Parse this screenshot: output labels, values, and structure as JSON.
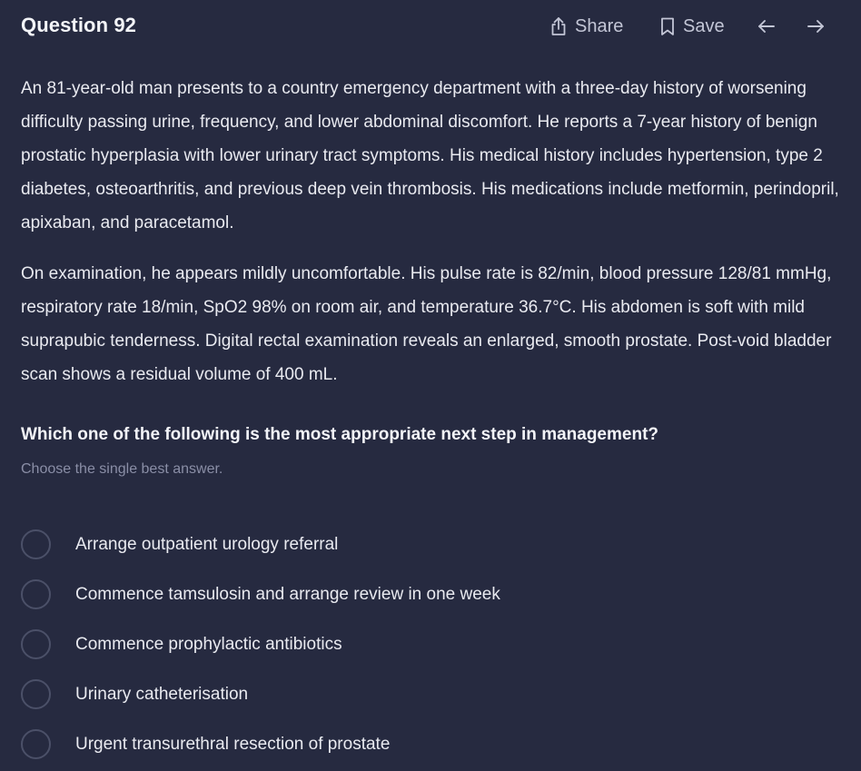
{
  "header": {
    "title": "Question 92",
    "share_label": "Share",
    "save_label": "Save",
    "icons": [
      "share-icon",
      "bookmark-icon",
      "arrow-left-icon",
      "arrow-right-icon"
    ]
  },
  "stem": {
    "paragraph1": "An 81-year-old man presents to a country emergency department with a three-day history of worsening difficulty passing urine, frequency, and lower abdominal discomfort. He reports a 7-year history of benign prostatic hyperplasia with lower urinary tract symptoms. His medical history includes hypertension, type 2 diabetes, osteoarthritis, and previous deep vein thrombosis. His medications include metformin, perindopril, apixaban, and paracetamol.",
    "paragraph2": "On examination, he appears mildly uncomfortable. His pulse rate is 82/min, blood pressure 128/81 mmHg, respiratory rate 18/min, SpO2 98% on room air, and temperature 36.7°C. His abdomen is soft with mild suprapubic tenderness. Digital rectal examination reveals an enlarged, smooth prostate. Post-void bladder scan shows a residual volume of 400 mL."
  },
  "question": {
    "lead_in": "Which one of the following is the most appropriate next step in management?",
    "hint": "Choose the single best answer.",
    "options": [
      {
        "label": "Arrange outpatient urology referral"
      },
      {
        "label": "Commence tamsulosin and arrange review in one week"
      },
      {
        "label": "Commence prophylactic antibiotics"
      },
      {
        "label": "Urinary catheterisation"
      },
      {
        "label": "Urgent transurethral resection of prostate"
      }
    ]
  },
  "colors": {
    "background": "#262a40",
    "text": "#e9eaf0",
    "muted": "#8a8ea6",
    "radio_border": "#4b5068"
  }
}
